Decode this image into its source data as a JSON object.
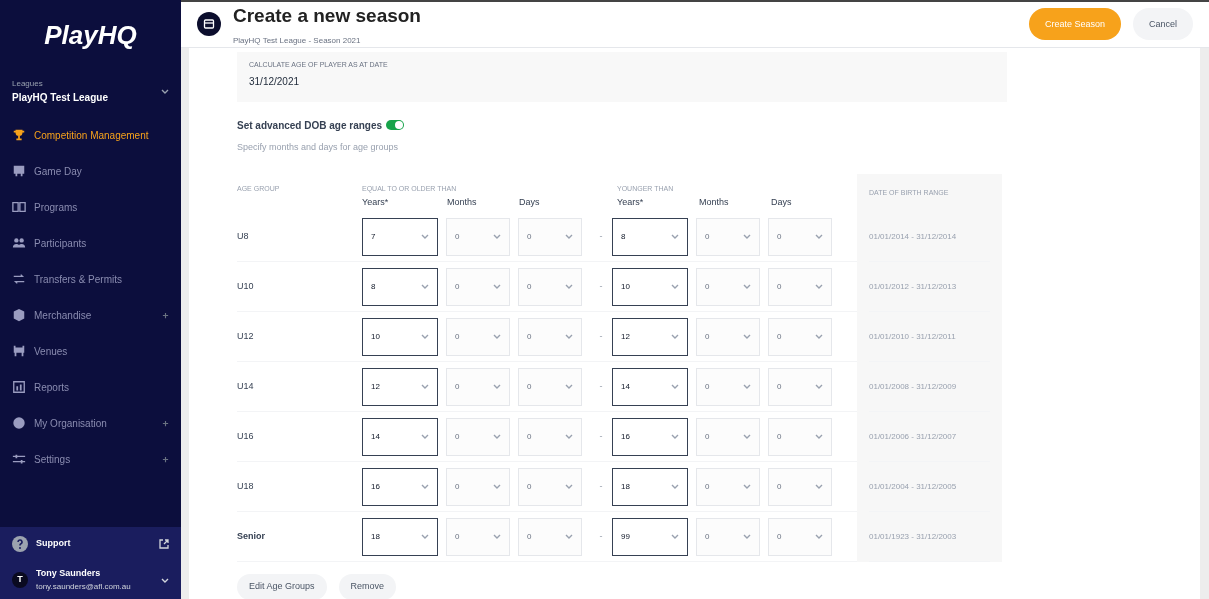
{
  "sidebar": {
    "logo": "PlayHQ",
    "org_label": "Leagues",
    "org_name": "PlayHQ Test League",
    "items": [
      {
        "label": "Competition Management",
        "selected": true,
        "has_chevron": false
      },
      {
        "label": "Game Day",
        "selected": false,
        "has_chevron": false
      },
      {
        "label": "Programs",
        "selected": false,
        "has_chevron": false
      },
      {
        "label": "Participants",
        "selected": false,
        "has_chevron": false
      },
      {
        "label": "Transfers & Permits",
        "selected": false,
        "has_chevron": false
      },
      {
        "label": "Merchandise",
        "selected": false,
        "has_chevron": true
      },
      {
        "label": "Venues",
        "selected": false,
        "has_chevron": false
      },
      {
        "label": "Reports",
        "selected": false,
        "has_chevron": false
      },
      {
        "label": "My Organisation",
        "selected": false,
        "has_chevron": true
      },
      {
        "label": "Settings",
        "selected": false,
        "has_chevron": true
      }
    ],
    "support": "Support",
    "user": {
      "initial": "T",
      "name": "Tony Saunders",
      "email": "tony.saunders@afl.com.au"
    }
  },
  "header": {
    "title": "Create a new season",
    "subtitle": "PlayHQ Test League - Season 2021",
    "buttons": [
      {
        "label": "Create Season",
        "kind": "primary"
      },
      {
        "label": "Cancel",
        "kind": "secondary"
      }
    ]
  },
  "age_date": {
    "label": "CALCULATE AGE OF PLAYER AS AT DATE",
    "value": "31/12/2021"
  },
  "advanced": {
    "label": "Set advanced DOB age ranges",
    "on": true,
    "hint": "Specify months and days for age groups"
  },
  "table": {
    "group_heading": "AGE GROUP",
    "from_heading": "EQUAL TO OR OLDER THAN",
    "to_heading": "YOUNGER THAN",
    "range_heading": "DATE OF BIRTH RANGE",
    "sub_headings": [
      "Years*",
      "Months",
      "Days",
      "Years*",
      "Months",
      "Days"
    ],
    "rows": [
      {
        "group": "U8",
        "separator": "-",
        "fields": [
          {
            "value": "7",
            "disabled": false
          },
          {
            "value": "0",
            "disabled": true
          },
          {
            "value": "0",
            "disabled": true
          },
          {
            "value": "8",
            "disabled": false
          },
          {
            "value": "0",
            "disabled": true
          },
          {
            "value": "0",
            "disabled": true
          }
        ],
        "range": "01/01/2014 - 31/12/2014"
      },
      {
        "group": "U10",
        "separator": "-",
        "fields": [
          {
            "value": "8",
            "disabled": false
          },
          {
            "value": "0",
            "disabled": true
          },
          {
            "value": "0",
            "disabled": true
          },
          {
            "value": "10",
            "disabled": false
          },
          {
            "value": "0",
            "disabled": true
          },
          {
            "value": "0",
            "disabled": true
          }
        ],
        "range": "01/01/2012 - 31/12/2013"
      },
      {
        "group": "U12",
        "separator": "-",
        "fields": [
          {
            "value": "10",
            "disabled": false
          },
          {
            "value": "0",
            "disabled": true
          },
          {
            "value": "0",
            "disabled": true
          },
          {
            "value": "12",
            "disabled": false
          },
          {
            "value": "0",
            "disabled": true
          },
          {
            "value": "0",
            "disabled": true
          }
        ],
        "range": "01/01/2010 - 31/12/2011"
      },
      {
        "group": "U14",
        "separator": "-",
        "fields": [
          {
            "value": "12",
            "disabled": false
          },
          {
            "value": "0",
            "disabled": true
          },
          {
            "value": "0",
            "disabled": true
          },
          {
            "value": "14",
            "disabled": false
          },
          {
            "value": "0",
            "disabled": true
          },
          {
            "value": "0",
            "disabled": true
          }
        ],
        "range": "01/01/2008 - 31/12/2009"
      },
      {
        "group": "U16",
        "separator": "-",
        "fields": [
          {
            "value": "14",
            "disabled": false
          },
          {
            "value": "0",
            "disabled": true
          },
          {
            "value": "0",
            "disabled": true
          },
          {
            "value": "16",
            "disabled": false
          },
          {
            "value": "0",
            "disabled": true
          },
          {
            "value": "0",
            "disabled": true
          }
        ],
        "range": "01/01/2006 - 31/12/2007"
      },
      {
        "group": "U18",
        "separator": "-",
        "fields": [
          {
            "value": "16",
            "disabled": false
          },
          {
            "value": "0",
            "disabled": true
          },
          {
            "value": "0",
            "disabled": true
          },
          {
            "value": "18",
            "disabled": false
          },
          {
            "value": "0",
            "disabled": true
          },
          {
            "value": "0",
            "disabled": true
          }
        ],
        "range": "01/01/2004 - 31/12/2005"
      },
      {
        "group": "Senior",
        "separator": "-",
        "fields": [
          {
            "value": "18",
            "disabled": false
          },
          {
            "value": "0",
            "disabled": true
          },
          {
            "value": "0",
            "disabled": true
          },
          {
            "value": "99",
            "disabled": false
          },
          {
            "value": "0",
            "disabled": true
          },
          {
            "value": "0",
            "disabled": true
          }
        ],
        "range": "01/01/1923 - 31/12/2003"
      }
    ]
  },
  "footer_buttons": [
    "Edit Age Groups",
    "Remove"
  ]
}
